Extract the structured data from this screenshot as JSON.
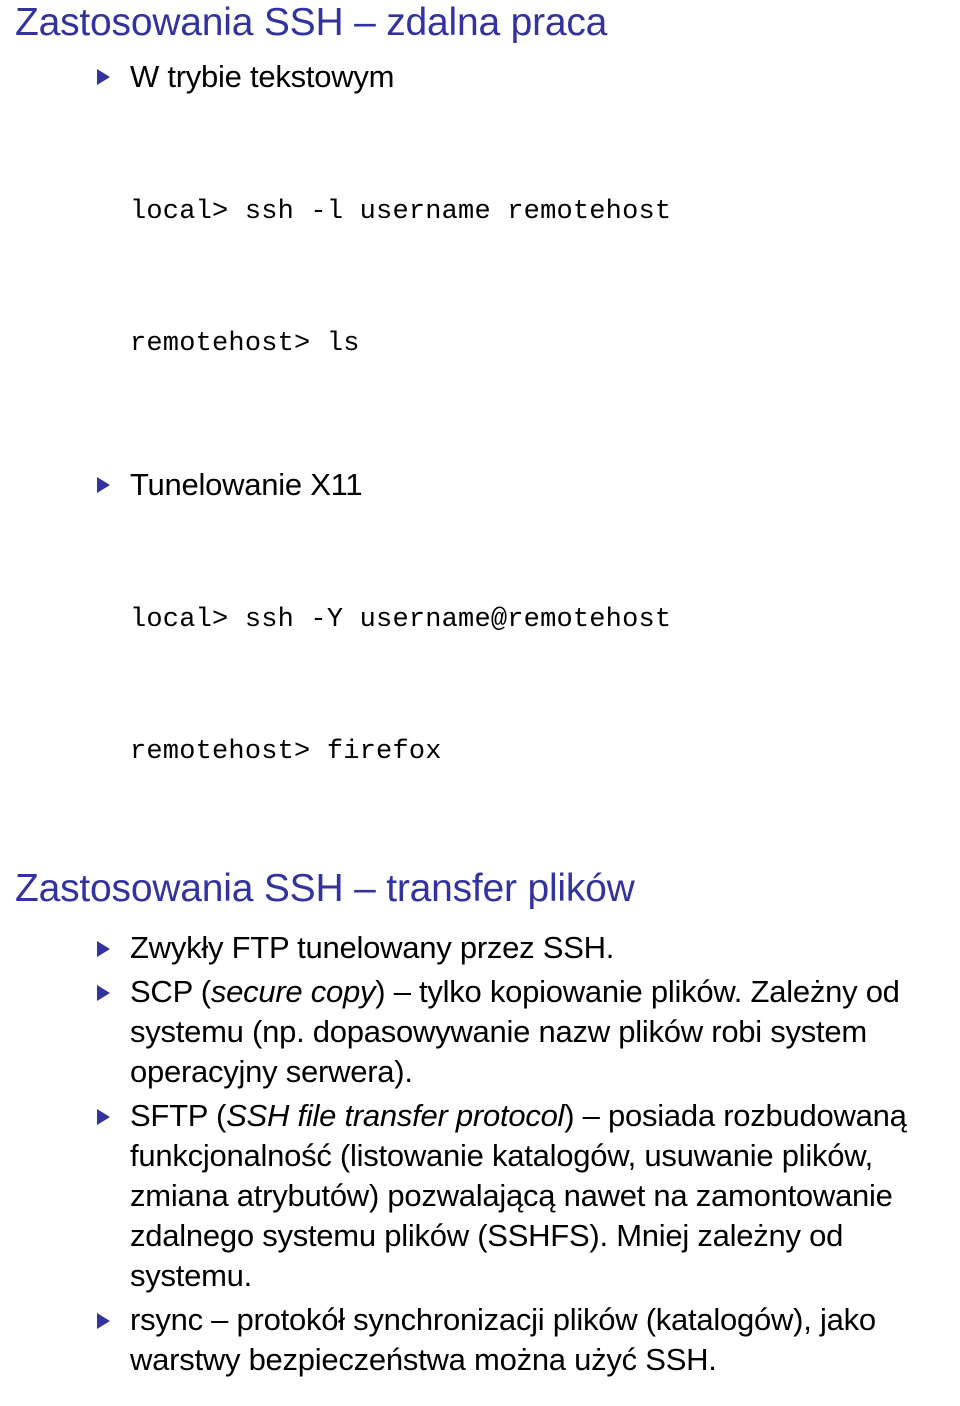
{
  "slides": [
    {
      "title": "Zastosowania SSH – zdalna praca",
      "items": [
        {
          "kind": "bullet",
          "text": "W trybie tekstowym"
        },
        {
          "kind": "code",
          "lines": [
            "local> ssh -l username remotehost",
            "remotehost> ls"
          ]
        },
        {
          "kind": "bullet",
          "text": "Tunelowanie X11"
        },
        {
          "kind": "code",
          "lines": [
            "local> ssh -Y username@remotehost",
            "remotehost> firefox"
          ]
        }
      ]
    },
    {
      "title": "Zastosowania SSH – transfer plików",
      "items": [
        {
          "kind": "bullet",
          "text": "Zwykły FTP tunelowany przez SSH."
        },
        {
          "kind": "bullet",
          "prefix": "SCP (",
          "italic": "secure copy",
          "suffix": ") – tylko kopiowanie plików. Zależny od systemu (np. dopasowywanie nazw plików robi system operacyjny serwera)."
        },
        {
          "kind": "bullet",
          "prefix": "SFTP (",
          "italic": "SSH file transfer protocol",
          "suffix": ") – posiada rozbudowaną funkcjonalność (listowanie katalogów, usuwanie plików, zmiana atrybutów) pozwalającą nawet na zamontowanie zdalnego systemu plików (SSHFS). Mniej zależny od systemu."
        },
        {
          "kind": "bullet",
          "text": "rsync – protokół synchronizacji plików (katalogów), jako warstwy bezpieczeństwa można użyć SSH."
        }
      ]
    }
  ],
  "colors": {
    "title": "#3333a0",
    "bullet_marker": "#3333a0",
    "body_text": "#000000",
    "background": "#ffffff"
  },
  "icons": {
    "bullet": "triangle-right-icon"
  }
}
